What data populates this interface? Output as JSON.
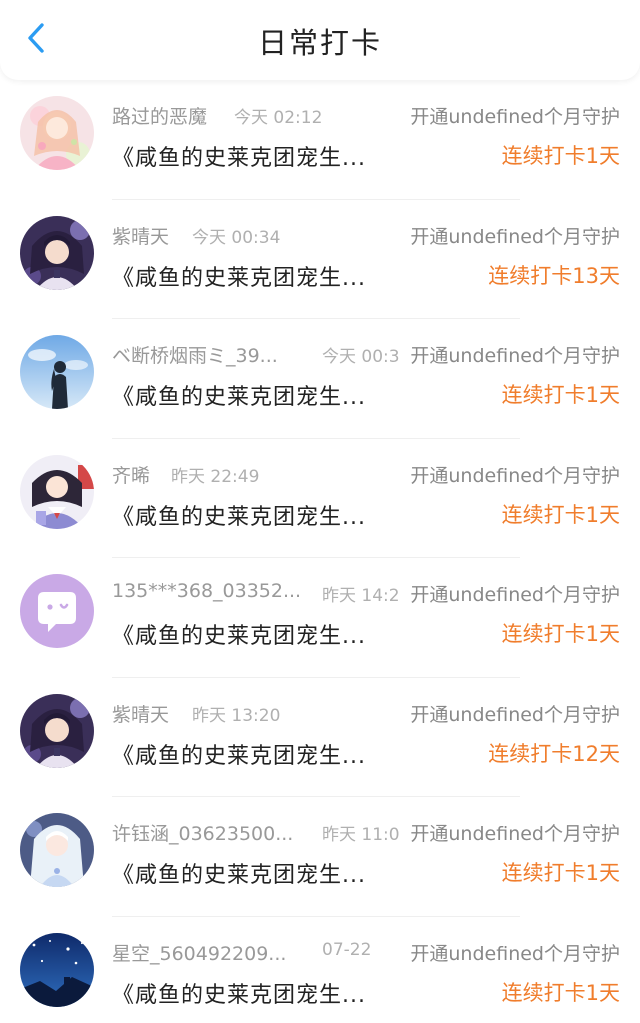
{
  "header": {
    "title": "日常打卡",
    "back_icon": "chevron-left-icon",
    "accent": "#2b9cf2"
  },
  "colors": {
    "streak": "#f07d2c",
    "meta": "#999999"
  },
  "rows": [
    {
      "user": "路过的恶魔",
      "time": "今天 02:12",
      "guard": "开通undefined个月守护",
      "book": "《咸鱼的史莱克团宠生...",
      "streak": "连续打卡1天",
      "avatar": "anime-girl-pink-avatar"
    },
    {
      "user": "紫晴天",
      "time": "今天 00:34",
      "guard": "开通undefined个月守护",
      "book": "《咸鱼的史莱克团宠生...",
      "streak": "连续打卡13天",
      "avatar": "anime-girl-dark-hair-avatar"
    },
    {
      "user": "ベ断桥烟雨ミ_39...",
      "time": "今天 00:3",
      "guard": "开通undefined个月守护",
      "book": "《咸鱼的史莱克团宠生...",
      "streak": "连续打卡1天",
      "avatar": "silhouette-sky-avatar"
    },
    {
      "user": "齐晞",
      "time": "昨天 22:49",
      "guard": "开通undefined个月守护",
      "book": "《咸鱼的史莱克团宠生...",
      "streak": "连续打卡1天",
      "avatar": "anime-girl-uniform-avatar"
    },
    {
      "user": "135***368_03352...",
      "time": "昨天 14:2",
      "guard": "开通undefined个月守护",
      "book": "《咸鱼的史莱克团宠生...",
      "streak": "连续打卡1天",
      "avatar": "default-chat-avatar"
    },
    {
      "user": "紫晴天",
      "time": "昨天 13:20",
      "guard": "开通undefined个月守护",
      "book": "《咸鱼的史莱克团宠生...",
      "streak": "连续打卡12天",
      "avatar": "anime-girl-dark-hair-avatar"
    },
    {
      "user": "许钰涵_03623500...",
      "time": "昨天 11:0",
      "guard": "开通undefined个月守护",
      "book": "《咸鱼的史莱克团宠生...",
      "streak": "连续打卡1天",
      "avatar": "anime-girl-white-hair-avatar"
    },
    {
      "user": "星空_560492209...",
      "time": "07-22",
      "guard": "开通undefined个月守护",
      "book": "《咸鱼的史莱克团宠生...",
      "streak": "连续打卡1天",
      "avatar": "starry-night-avatar"
    }
  ]
}
